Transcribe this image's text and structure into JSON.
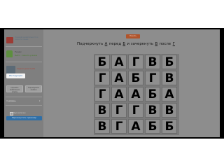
{
  "sidebar": {
    "app_title": "Тренажёр внимательности и скорости чтения",
    "student_name": "Ученик",
    "student_link": "Выйти · Сменить ученика",
    "game_caption": "Корректурная проба",
    "tooltip": "Инструкция",
    "option_left": "Скрывать правильные ответы",
    "option_right": "Подсвечивать ошибки",
    "level_label": "4 уровень",
    "checkbox_label": "Звук включен",
    "restart_label": "Перезапустить тренажер"
  },
  "top_button": "Начать",
  "instruction": {
    "part1": "Подчеркнуть",
    "letter1": "А",
    "part2": "перед",
    "letter2": "Б",
    "part3": "и зачеркнуть",
    "letter3": "В",
    "part4": "после",
    "letter4": "Г"
  },
  "grid": [
    [
      "Б",
      "А",
      "Г",
      "В",
      "Б"
    ],
    [
      "Г",
      "А",
      "Б",
      "Г",
      "В"
    ],
    [
      "Г",
      "А",
      "А",
      "Б",
      "А"
    ],
    [
      "В",
      "Г",
      "Г",
      "В",
      "В"
    ],
    [
      "В",
      "Г",
      "А",
      "Б",
      "Б"
    ]
  ]
}
